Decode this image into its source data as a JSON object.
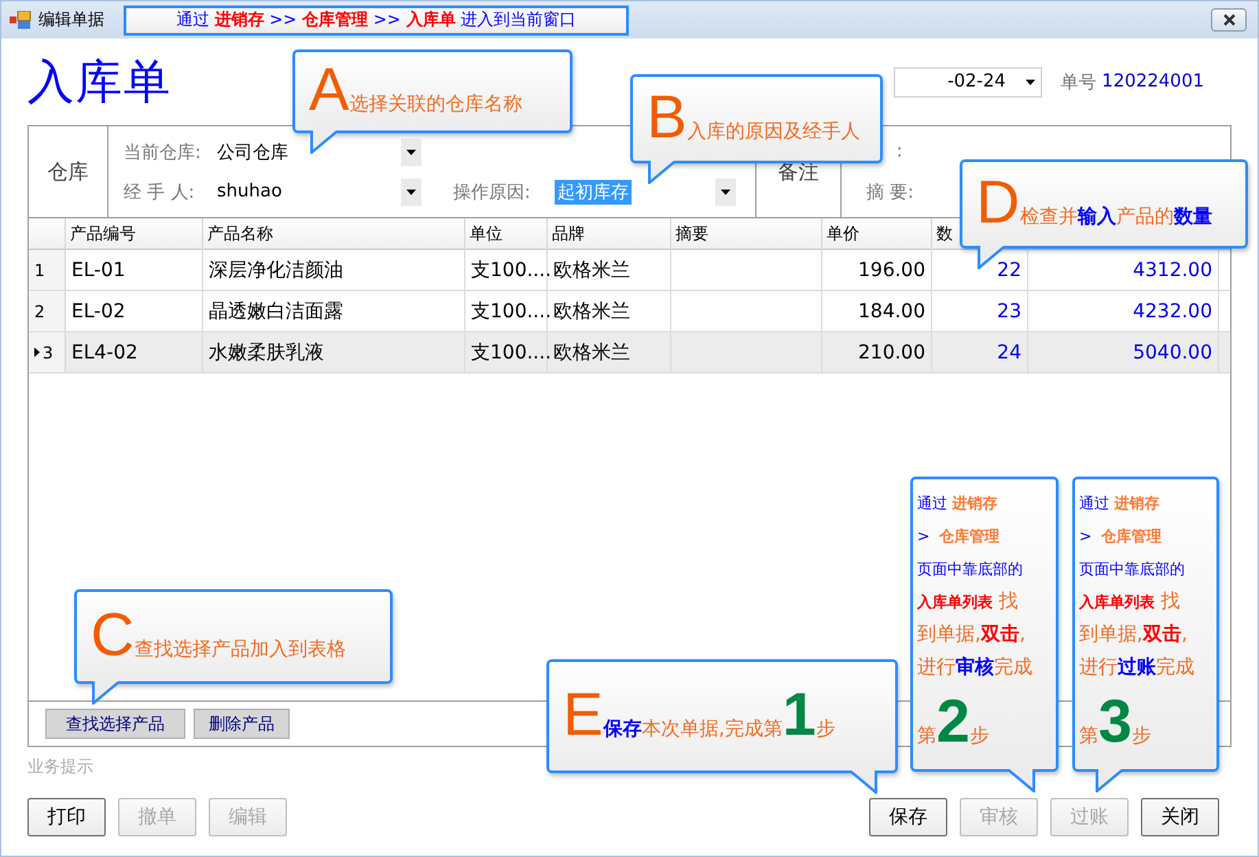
{
  "window": {
    "title": "编辑单据"
  },
  "banner": [
    {
      "kind": "plain",
      "text": "通过 "
    },
    {
      "kind": "key",
      "text": "进销存"
    },
    {
      "kind": "plain",
      "text": " >> "
    },
    {
      "kind": "key",
      "text": "仓库管理"
    },
    {
      "kind": "plain",
      "text": " >> "
    },
    {
      "kind": "key",
      "text": "入库单"
    },
    {
      "kind": "plain",
      "text": " 进入到当前窗口"
    }
  ],
  "heading": "入库单",
  "date": {
    "value": "-02-24"
  },
  "doc_number": {
    "label": "单号",
    "value": "120224001"
  },
  "form": {
    "section": "仓库",
    "fields": [
      {
        "label": "当前仓库:",
        "value": "公司仓库",
        "highlighted": false
      },
      {
        "label": "经 手 人:",
        "value": "shuhao",
        "highlighted": false
      },
      {
        "label": "操作原因:",
        "value": "起初库存",
        "highlighted": true
      }
    ],
    "remark": {
      "section": "备注",
      "label_cut": ":",
      "label": "摘 要:"
    }
  },
  "table": {
    "columns": [
      "产品编号",
      "产品名称",
      "单位",
      "品牌",
      "摘要",
      "单价",
      "数"
    ],
    "rows": [
      {
        "number": "1",
        "selected": false,
        "cells": [
          "EL-01",
          "深层净化洁颜油",
          "支100....",
          "欧格米兰",
          "",
          "196.00",
          "22",
          "4312.00"
        ]
      },
      {
        "number": "2",
        "selected": false,
        "cells": [
          "EL-02",
          "晶透嫩白洁面露",
          "支100....",
          "欧格米兰",
          "",
          "184.00",
          "23",
          "4232.00"
        ]
      },
      {
        "number": "3",
        "selected": true,
        "cells": [
          "EL4-02",
          "水嫩柔肤乳液",
          "支100....",
          "欧格米兰",
          "",
          "210.00",
          "24",
          "5040.00"
        ]
      }
    ]
  },
  "table_buttons": [
    {
      "label": "查找选择产品"
    },
    {
      "label": "删除产品"
    }
  ],
  "hint": "业务提示",
  "left_buttons": [
    {
      "label": "打印",
      "disabled": false
    },
    {
      "label": "撤单",
      "disabled": true
    },
    {
      "label": "编辑",
      "disabled": true
    }
  ],
  "right_buttons": [
    {
      "label": "保存",
      "disabled": false
    },
    {
      "label": "审核",
      "disabled": true
    },
    {
      "label": "过账",
      "disabled": true
    },
    {
      "label": "关闭",
      "disabled": false
    }
  ],
  "callouts": [
    {
      "kind": "wide",
      "segments": [
        {
          "kind": "letter",
          "text": "A"
        },
        {
          "kind": "note",
          "text": "选择关联的仓库名称"
        }
      ]
    },
    {
      "kind": "wide",
      "segments": [
        {
          "kind": "letter",
          "text": "B"
        },
        {
          "kind": "note",
          "text": "入库的原因及经手人"
        }
      ]
    },
    {
      "kind": "wide",
      "segments": [
        {
          "kind": "letter",
          "text": "C"
        },
        {
          "kind": "note",
          "text": "查找选择产品加入到表格"
        }
      ]
    },
    {
      "kind": "wide",
      "segments": [
        {
          "kind": "letter",
          "text": "D"
        },
        {
          "kind": "note",
          "text": "检查并"
        },
        {
          "kind": "key",
          "text": "输入"
        },
        {
          "kind": "note",
          "text": "产品的"
        },
        {
          "kind": "key",
          "text": "数量"
        }
      ]
    },
    {
      "kind": "wide",
      "segments": [
        {
          "kind": "letter",
          "text": "E"
        },
        {
          "kind": "key",
          "text": "保存"
        },
        {
          "kind": "note",
          "text": "本次单据,完成第"
        },
        {
          "kind": "digit",
          "text": "1"
        },
        {
          "kind": "note",
          "text": "步"
        }
      ]
    },
    {
      "kind": "tall",
      "segments": [
        {
          "kind": "path",
          "text": "通过 "
        },
        {
          "kind": "path-key",
          "text": "进销存"
        },
        {
          "kind": "break"
        },
        {
          "kind": "path",
          "text": ">  "
        },
        {
          "kind": "path-key",
          "text": "仓库管理"
        },
        {
          "kind": "break"
        },
        {
          "kind": "path",
          "text": "页面中靠底部的"
        },
        {
          "kind": "break"
        },
        {
          "kind": "list-key",
          "text": "入库单列表"
        },
        {
          "kind": "note",
          "text": " 找"
        },
        {
          "kind": "break"
        },
        {
          "kind": "note",
          "text": "到单据,"
        },
        {
          "kind": "action",
          "text": "双击"
        },
        {
          "kind": "note",
          "text": ","
        },
        {
          "kind": "break"
        },
        {
          "kind": "note",
          "text": "进行"
        },
        {
          "kind": "key",
          "text": "审核"
        },
        {
          "kind": "note",
          "text": "完成"
        }
      ],
      "step": [
        {
          "kind": "note",
          "text": "第"
        },
        {
          "kind": "digit",
          "text": "2"
        },
        {
          "kind": "note",
          "text": "步"
        }
      ]
    },
    {
      "kind": "tall",
      "segments": [
        {
          "kind": "path",
          "text": "通过 "
        },
        {
          "kind": "path-key",
          "text": "进销存"
        },
        {
          "kind": "break"
        },
        {
          "kind": "path",
          "text": ">  "
        },
        {
          "kind": "path-key",
          "text": "仓库管理"
        },
        {
          "kind": "break"
        },
        {
          "kind": "path",
          "text": "页面中靠底部的"
        },
        {
          "kind": "break"
        },
        {
          "kind": "list-key",
          "text": "入库单列表"
        },
        {
          "kind": "note",
          "text": " 找"
        },
        {
          "kind": "break"
        },
        {
          "kind": "note",
          "text": "到单据,"
        },
        {
          "kind": "action",
          "text": "双击"
        },
        {
          "kind": "note",
          "text": ","
        },
        {
          "kind": "break"
        },
        {
          "kind": "note",
          "text": "进行"
        },
        {
          "kind": "key",
          "text": "过账"
        },
        {
          "kind": "note",
          "text": "完成"
        }
      ],
      "step": [
        {
          "kind": "note",
          "text": "第"
        },
        {
          "kind": "digit",
          "text": "3"
        },
        {
          "kind": "note",
          "text": "步"
        }
      ]
    }
  ]
}
